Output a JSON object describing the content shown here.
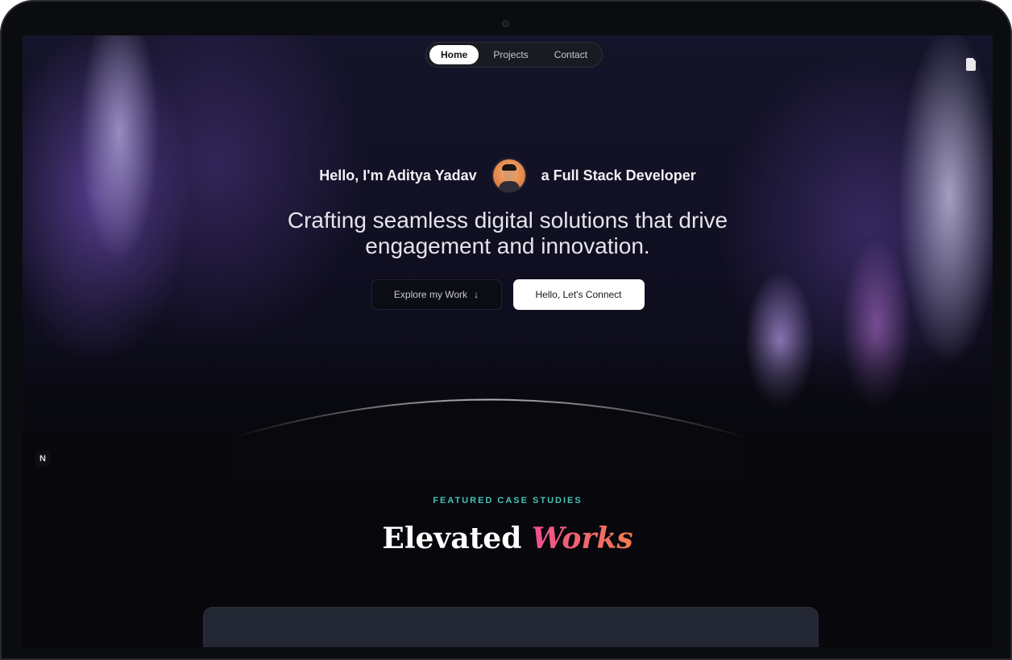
{
  "nav": {
    "items": [
      {
        "label": "Home",
        "active": true
      },
      {
        "label": "Projects",
        "active": false
      },
      {
        "label": "Contact",
        "active": false
      }
    ],
    "resume_icon": "document-icon"
  },
  "hero": {
    "intro_left": "Hello, I'm Aditya Yadav",
    "intro_right": "a Full Stack Developer",
    "avatar_icon": "avatar-portrait",
    "tagline_line1": "Crafting seamless digital solutions that drive",
    "tagline_line2": "engagement and innovation.",
    "cta_secondary": "Explore my Work",
    "cta_secondary_icon": "↓",
    "cta_primary": "Hello, Let's Connect"
  },
  "side_badge": "N",
  "featured": {
    "eyebrow": "FEATURED CASE STUDIES",
    "title_plain": "Elevated",
    "title_accent": "Works"
  },
  "colors": {
    "accent_teal": "#49c2b4",
    "accent_pink": "#f0508e",
    "accent_orange": "#f47a4f",
    "background": "#07070c"
  }
}
